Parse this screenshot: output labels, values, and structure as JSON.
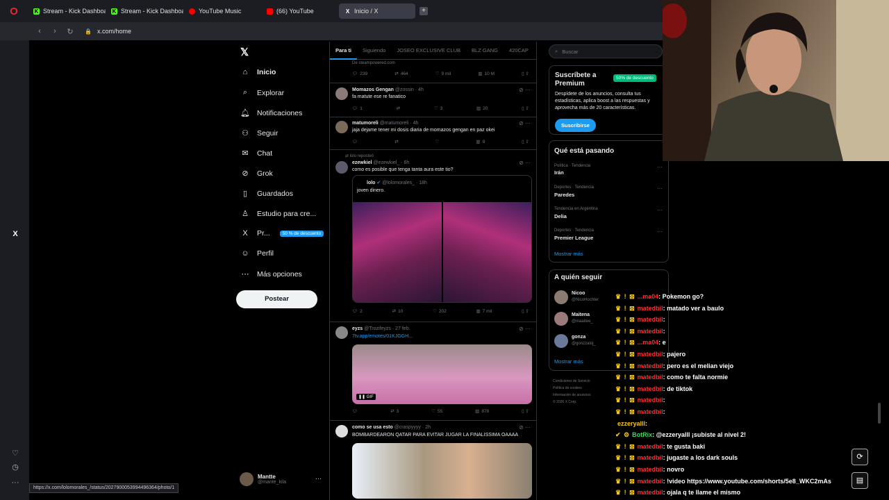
{
  "browser": {
    "tabs": [
      {
        "label": "Stream - Kick Dashboard",
        "icon": "kick-icon",
        "color": "#53fc18"
      },
      {
        "label": "Stream - Kick Dashboard",
        "icon": "kick-icon",
        "color": "#53fc18"
      },
      {
        "label": "YouTube Music",
        "icon": "youtube-music-icon",
        "color": "#ff0000"
      },
      {
        "label": "(66) YouTube",
        "icon": "youtube-icon",
        "color": "#ff0000"
      },
      {
        "label": "Inicio / X",
        "icon": "x-icon",
        "color": "#ffffff"
      }
    ],
    "url": "x.com/home",
    "status_url": "https://x.com/lolomorales_/status/2027900053994496364/photo/1"
  },
  "x_nav": {
    "items": [
      {
        "label": "Inicio",
        "icon": "home-icon"
      },
      {
        "label": "Explorar",
        "icon": "search-icon"
      },
      {
        "label": "Notificaciones",
        "icon": "bell-icon"
      },
      {
        "label": "Seguir",
        "icon": "follow-icon"
      },
      {
        "label": "Chat",
        "icon": "mail-icon"
      },
      {
        "label": "Grok",
        "icon": "grok-icon"
      },
      {
        "label": "Guardados",
        "icon": "bookmark-icon"
      },
      {
        "label": "Estudio para cre...",
        "icon": "studio-icon"
      },
      {
        "label": "Pr...",
        "icon": "x-premium-icon"
      },
      {
        "label": "Perfil",
        "icon": "profile-icon"
      },
      {
        "label": "Más opciones",
        "icon": "more-icon"
      }
    ],
    "premium_badge": "50 % de descuento",
    "post_label": "Postear",
    "account": {
      "name": "Mantte",
      "handle": "@mante_kila"
    }
  },
  "feed": {
    "tabs": [
      "Para ti",
      "Siguiendo",
      "JOSEO EXCLUSIVE CLUB",
      "BLZ GANG",
      "420CAP"
    ],
    "top_source": "De steampowered.com",
    "top_actions": [
      "239",
      "464",
      "9 mil",
      "10 M"
    ],
    "tweets": [
      {
        "name": "Momazos Gengan",
        "handle": "@zossin",
        "time": "4h",
        "text": "fa matute ese re fanatico",
        "actions": [
          "1",
          "",
          "3",
          "20"
        ]
      },
      {
        "name": "matumoreli",
        "handle": "@matumoreli",
        "time": "4h",
        "text": "jaja dejame tener mi dosis diaria de momazos gengan en paz okei",
        "actions": [
          "",
          "",
          "",
          "9"
        ]
      },
      {
        "repost": "lolo reposteó",
        "name": "ezewkiel",
        "handle": "@ezewkiel_",
        "time": "6h",
        "text": "como es posible que tenga tanta aura este tio?",
        "quote_name": "lolo",
        "quote_handle": "@lolomorales_",
        "quote_time": "18h",
        "quote_text": "joven dinero.",
        "actions": [
          "2",
          "10",
          "202",
          "7 mil"
        ]
      },
      {
        "name": "eyzs",
        "handle": "@Trozifeyzs",
        "time": "27 feb.",
        "text": "7tv.app/emotes/01KJGGH...",
        "gif_label": "GIF",
        "actions": [
          "",
          "3",
          "55",
          "878"
        ]
      },
      {
        "name": "como se usa esto",
        "handle": "@craspyyyy",
        "time": "2h",
        "text": "BOMBARDEARON QATAR PARA EVITAR JUGAR LA FINALISSIMA OAAAA"
      }
    ]
  },
  "right": {
    "search_placeholder": "Buscar",
    "premium": {
      "title": "Suscríbete a Premium",
      "discount": "50% de descuento",
      "desc": "Despídete de los anuncios, consulta tus estadísticas, aplica boost a las respuestas y aprovecha más de 20 características.",
      "button": "Suscribirse"
    },
    "trends_title": "Qué está pasando",
    "trends": [
      {
        "cat": "Política · Tendencia",
        "name": "Irán"
      },
      {
        "cat": "Deportes · Tendencia",
        "name": "Paredes"
      },
      {
        "cat": "Tendencia en Argentina",
        "name": "Delia"
      },
      {
        "cat": "Deportes · Tendencia",
        "name": "Premier League"
      }
    ],
    "show_more": "Mostrar más",
    "follow_title": "A quién seguir",
    "follow": [
      {
        "name": "Nicoo",
        "handle": "@NicoHochter"
      },
      {
        "name": "Maitena",
        "handle": "@maaitee_"
      },
      {
        "name": "gonza",
        "handle": "@gonzzaloj_"
      }
    ],
    "footer": [
      "Condiciones de Servicio",
      "Política de cookies",
      "Información de anuncios",
      "© 2026 X Corp."
    ]
  },
  "chat": [
    {
      "badges": "♛ ! ⊠",
      "user": "...ma04",
      "msg": ": Pokemon go?"
    },
    {
      "badges": "♛ ! ⊠",
      "user": "matedbil",
      "msg": ": matado ver a baulo"
    },
    {
      "badges": "♛ ! ⊠",
      "user": "matedbil",
      "msg": ":"
    },
    {
      "badges": "♛ ! ⊠",
      "user": "matedbil",
      "msg": ":"
    },
    {
      "badges": "♛ ! ⊠",
      "user": "...ma04",
      "msg": ": e"
    },
    {
      "badges": "♛ ! ⊠",
      "user": "matedbil",
      "msg": ": pajero"
    },
    {
      "badges": "♛ ! ⊠",
      "user": "matedbil",
      "msg": ": pero es el melian viejo"
    },
    {
      "badges": "♛ ! ⊠",
      "user": "matedbil",
      "msg": ": como te falta normie"
    },
    {
      "badges": "♛ ! ⊠",
      "user": "matedbil",
      "msg": ": de tiktok"
    },
    {
      "badges": "♛ ! ⊠",
      "user": "matedbil",
      "msg": ":"
    },
    {
      "badges": "♛ ! ⊠",
      "user": "matedbil",
      "msg": ":"
    },
    {
      "badges": "",
      "user": "ezzeryalll",
      "msg": ":",
      "style": "gold"
    },
    {
      "badges": "✔ ⚙",
      "user": "BotRix",
      "msg": ": @ezzeryalll ¡subiste al nivel 2!",
      "style": "green"
    },
    {
      "badges": "♛ ! ⊠",
      "user": "matedbil",
      "msg": ": te gusta baki"
    },
    {
      "badges": "♛ ! ⊠",
      "user": "matedbil",
      "msg": ": jugaste a los dark souls"
    },
    {
      "badges": "♛ ! ⊠",
      "user": "matedbil",
      "msg": ": novro"
    },
    {
      "badges": "♛ ! ⊠",
      "user": "matedbil",
      "msg": ": !video https://www.youtube.com/shorts/5e8_WKC2mAs"
    },
    {
      "badges": "♛ ! ⊠",
      "user": "matedbil",
      "msg": ": ojala q te llame el mismo"
    }
  ]
}
